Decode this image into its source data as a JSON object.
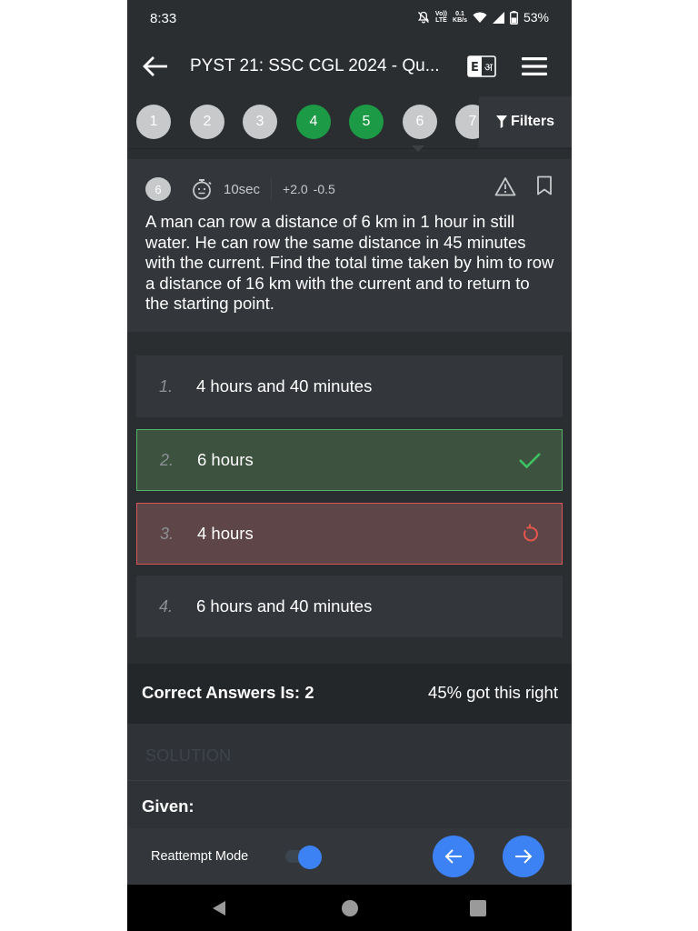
{
  "status_bar": {
    "time": "8:33",
    "volte_top": "Vo))",
    "volte_bottom": "LTE",
    "speed_top": "0.1",
    "speed_bottom": "KB/s",
    "battery": "53%"
  },
  "app_bar": {
    "title": "PYST 21: SSC CGL 2024 - Qu...",
    "lang_icon": "english-hindi-toggle-icon",
    "lang_left": "E",
    "lang_right": "अ"
  },
  "question_nav": {
    "items": [
      {
        "label": "1",
        "state": "unattempted"
      },
      {
        "label": "2",
        "state": "unattempted"
      },
      {
        "label": "3",
        "state": "unattempted"
      },
      {
        "label": "4",
        "state": "correct"
      },
      {
        "label": "5",
        "state": "correct"
      },
      {
        "label": "6",
        "state": "unattempted"
      },
      {
        "label": "7",
        "state": "unattempted"
      }
    ],
    "filters_label": "Filters"
  },
  "question": {
    "number": "6",
    "time_taken": "10sec",
    "marks_positive": "+2.0",
    "marks_negative": "-0.5",
    "text": "A man can row a distance of 6 km in 1 hour in still water. He can row the same distance in 45 minutes with the current. Find the total time taken by him to row a distance of 16 km with the current and to return to the starting point."
  },
  "options": [
    {
      "num": "1.",
      "text": "4 hours and 40 minutes",
      "state": "neutral"
    },
    {
      "num": "2.",
      "text": "6 hours",
      "state": "correct"
    },
    {
      "num": "3.",
      "text": "4 hours",
      "state": "wrong"
    },
    {
      "num": "4.",
      "text": "6 hours and 40 minutes",
      "state": "neutral"
    }
  ],
  "summary": {
    "correct_answer": "Correct Answers Is: 2",
    "percent_right": "45% got this right"
  },
  "solution": {
    "heading": "SOLUTION",
    "given": "Given:"
  },
  "bottom_bar": {
    "reattempt_label": "Reattempt Mode",
    "reattempt_on": true
  },
  "colors": {
    "background": "#2b2e31",
    "card": "#33363a",
    "accent_blue": "#3d82f5",
    "correct_green": "#1c9a45",
    "wrong_red": "#d9555a"
  }
}
